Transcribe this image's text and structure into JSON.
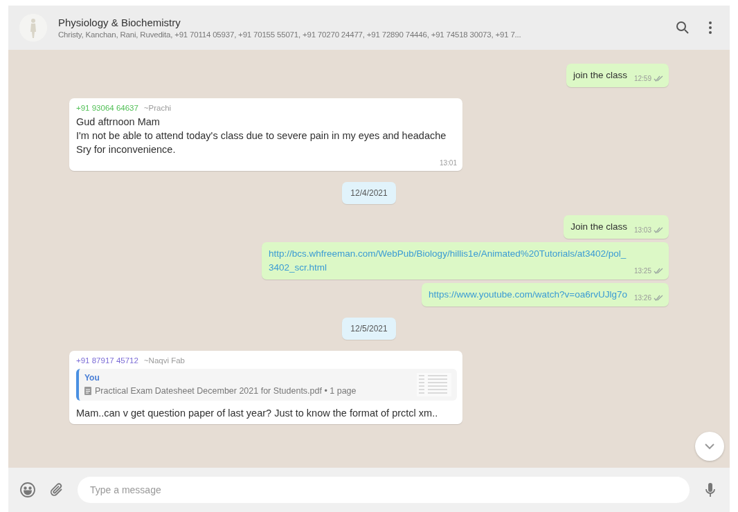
{
  "header": {
    "title": "Physiology & Biochemistry",
    "members": "Christy, Kanchan, Rani, Ruvedita, +91 70114 05937, +91 70155 55071, +91 70270 24477, +91 72890 74446, +91 74518 30073, +91 7..."
  },
  "messages": [
    {
      "kind": "outgoing",
      "text": "join the class",
      "link": false,
      "time": "12:59"
    },
    {
      "kind": "incoming",
      "phone": "+91 93064 64637",
      "name": "~Prachi",
      "color": "#4fbf54",
      "text": "Gud aftrnoon Mam\nI'm not be able to attend today's class due to severe pain in my eyes and headache\nSry for inconvenience.",
      "time": "13:01"
    },
    {
      "kind": "date",
      "text": "12/4/2021"
    },
    {
      "kind": "outgoing",
      "text": "Join the class",
      "link": false,
      "time": "13:03"
    },
    {
      "kind": "outgoing",
      "text": "http://bcs.whfreeman.com/WebPub/Biology/hillis1e/Animated%20Tutorials/at3402/pol_3402_scr.html",
      "link": true,
      "time": "13:25"
    },
    {
      "kind": "outgoing",
      "text": "https://www.youtube.com/watch?v=oa6rvUJlg7o",
      "link": true,
      "time": "13:26"
    },
    {
      "kind": "date",
      "text": "12/5/2021"
    },
    {
      "kind": "incoming",
      "phone": "+91 87917 45712",
      "name": "~Naqvi Fab",
      "color": "#7b6bd6",
      "quote": {
        "author": "You",
        "file": "Practical Exam Datesheet December 2021 for Students.pdf • 1 page"
      },
      "text": "Mam..can v get question paper of last year? Just to know the format of prctcl xm.."
    }
  ],
  "composer": {
    "placeholder": "Type a message"
  }
}
